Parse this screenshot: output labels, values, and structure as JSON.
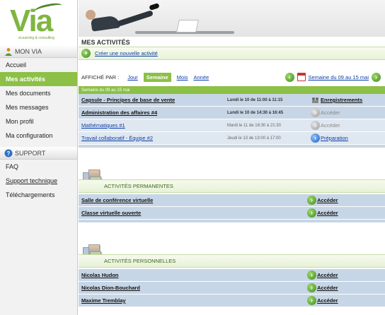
{
  "logo": {
    "text": "Via",
    "tagline": "eLearning & consulting"
  },
  "sidebar": {
    "my_via_header": "MON VIA",
    "items": [
      {
        "label": "Accueil"
      },
      {
        "label": "Mes activités"
      },
      {
        "label": "Mes documents"
      },
      {
        "label": "Mes messages"
      },
      {
        "label": "Mon profil"
      },
      {
        "label": "Ma configuration"
      }
    ],
    "support_header": "SUPPORT",
    "support_items": [
      {
        "label": "FAQ"
      },
      {
        "label": "Support technique"
      },
      {
        "label": "Téléchargements"
      }
    ]
  },
  "main": {
    "title": "MES ACTIVITÉS",
    "create_link": "Créer une nouvelle activité",
    "filter": {
      "label": "AFFICHÉ PAR :",
      "options": [
        "Jour",
        "Semaine",
        "Mois",
        "Année"
      ],
      "selected": "Semaine"
    },
    "week_nav": {
      "range_label": "Semaine du 09 au 15 mai"
    },
    "week_band": "Semaine du 09 au 15 mai",
    "activities": [
      {
        "name": "Capsule - Principes de base de vente",
        "when": "Lundi le 10 de 11:00 à 11:15",
        "action": "Enregistrements"
      },
      {
        "name": "Administration des affaires #4",
        "when": "Lundi le 10 de 14:30 à 16:45",
        "action": "Accéder"
      },
      {
        "name": "Mathématiques #1",
        "when": "Mardi le 11 de 18:30 à 21:30",
        "action": "Accéder"
      },
      {
        "name": "Travail collaboratif - Équipe #2",
        "when": "Jeudi le 13 de 13:00 à 17:00",
        "action": "Préparation"
      }
    ],
    "permanent": {
      "title": "ACTIVITÉS PERMANENTES",
      "rows": [
        {
          "name": "Salle de conférence virtuelle",
          "action": "Accéder"
        },
        {
          "name": "Classe virtuelle ouverte",
          "action": "Accéder"
        }
      ]
    },
    "personal": {
      "title": "ACTIVITÉS PERSONNELLES",
      "rows": [
        {
          "name": "Nicolas Hudon",
          "action": "Accéder"
        },
        {
          "name": "Nicolas Dion-Bouchard",
          "action": "Accéder"
        },
        {
          "name": "Maxime Tremblay",
          "action": "Accéder"
        }
      ]
    }
  },
  "colors": {
    "accent_green": "#8cc046",
    "link_blue": "#0b3ea8",
    "row_blue": "#c7d6e6"
  }
}
